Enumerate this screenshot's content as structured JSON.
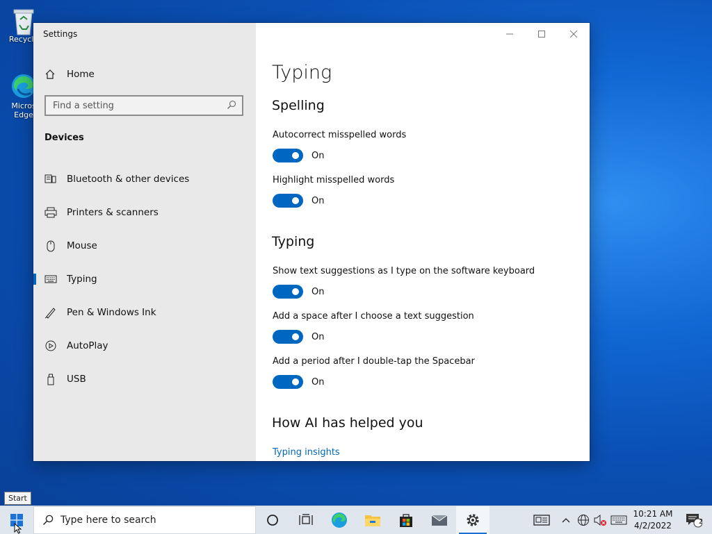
{
  "desktop": {
    "icons": [
      {
        "label": "Recycle"
      },
      {
        "label": "Micros Edge"
      }
    ]
  },
  "window": {
    "title": "Settings",
    "sidebar": {
      "home_label": "Home",
      "search_placeholder": "Find a setting",
      "section": "Devices",
      "items": [
        {
          "label": "Bluetooth & other devices",
          "icon": "bluetooth-devices-icon"
        },
        {
          "label": "Printers & scanners",
          "icon": "printer-icon"
        },
        {
          "label": "Mouse",
          "icon": "mouse-icon"
        },
        {
          "label": "Typing",
          "icon": "keyboard-icon",
          "selected": true
        },
        {
          "label": "Pen & Windows Ink",
          "icon": "pen-icon"
        },
        {
          "label": "AutoPlay",
          "icon": "autoplay-icon"
        },
        {
          "label": "USB",
          "icon": "usb-icon"
        }
      ]
    },
    "content": {
      "title": "Typing",
      "sections": [
        {
          "heading": "Spelling",
          "settings": [
            {
              "label": "Autocorrect misspelled words",
              "state": "On"
            },
            {
              "label": "Highlight misspelled words",
              "state": "On"
            }
          ]
        },
        {
          "heading": "Typing",
          "settings": [
            {
              "label": "Show text suggestions as I type on the software keyboard",
              "state": "On"
            },
            {
              "label": "Add a space after I choose a text suggestion",
              "state": "On"
            },
            {
              "label": "Add a period after I double-tap the Spacebar",
              "state": "On"
            }
          ]
        },
        {
          "heading": "How AI has helped you",
          "link": "Typing insights"
        }
      ]
    }
  },
  "tooltip": "Start",
  "taskbar": {
    "search_placeholder": "Type here to search",
    "time": "10:21 AM",
    "date": "4/2/2022",
    "notification_count": "2"
  },
  "colors": {
    "accent": "#0067c0",
    "link": "#0067b8"
  }
}
